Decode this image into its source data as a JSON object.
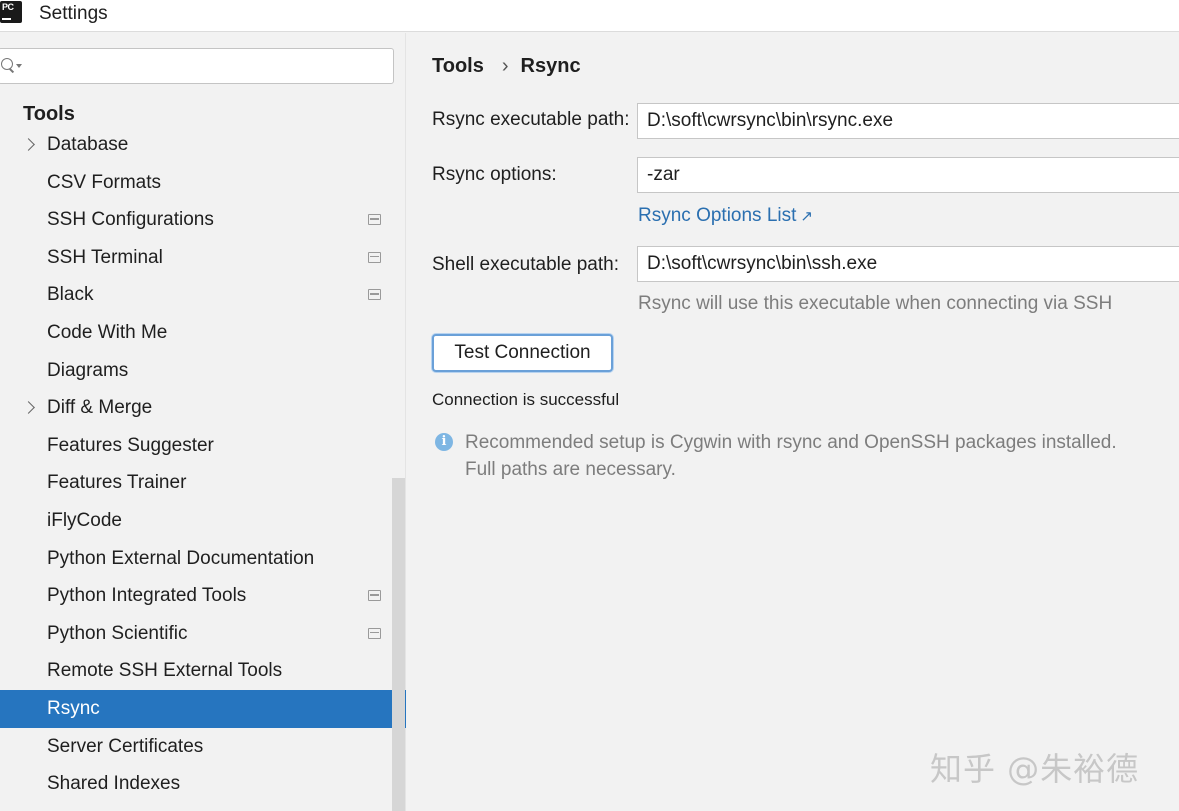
{
  "window": {
    "title": "Settings",
    "app_icon_text": "PC"
  },
  "sidebar": {
    "search": {
      "value": "",
      "placeholder": ""
    },
    "section_title": "Tools",
    "items": [
      {
        "label": "Database",
        "expandable": true,
        "project_icon": false,
        "selected": false
      },
      {
        "label": "CSV Formats",
        "expandable": false,
        "project_icon": false,
        "selected": false
      },
      {
        "label": "SSH Configurations",
        "expandable": false,
        "project_icon": true,
        "selected": false
      },
      {
        "label": "SSH Terminal",
        "expandable": false,
        "project_icon": true,
        "selected": false
      },
      {
        "label": "Black",
        "expandable": false,
        "project_icon": true,
        "selected": false
      },
      {
        "label": "Code With Me",
        "expandable": false,
        "project_icon": false,
        "selected": false
      },
      {
        "label": "Diagrams",
        "expandable": false,
        "project_icon": false,
        "selected": false
      },
      {
        "label": "Diff & Merge",
        "expandable": true,
        "project_icon": false,
        "selected": false
      },
      {
        "label": "Features Suggester",
        "expandable": false,
        "project_icon": false,
        "selected": false
      },
      {
        "label": "Features Trainer",
        "expandable": false,
        "project_icon": false,
        "selected": false
      },
      {
        "label": "iFlyCode",
        "expandable": false,
        "project_icon": false,
        "selected": false
      },
      {
        "label": "Python External Documentation",
        "expandable": false,
        "project_icon": false,
        "selected": false
      },
      {
        "label": "Python Integrated Tools",
        "expandable": false,
        "project_icon": true,
        "selected": false
      },
      {
        "label": "Python Scientific",
        "expandable": false,
        "project_icon": true,
        "selected": false
      },
      {
        "label": "Remote SSH External Tools",
        "expandable": false,
        "project_icon": false,
        "selected": false
      },
      {
        "label": "Rsync",
        "expandable": false,
        "project_icon": false,
        "selected": true
      },
      {
        "label": "Server Certificates",
        "expandable": false,
        "project_icon": false,
        "selected": false
      },
      {
        "label": "Shared Indexes",
        "expandable": false,
        "project_icon": false,
        "selected": false
      }
    ]
  },
  "main": {
    "breadcrumb": {
      "parent": "Tools",
      "separator": "›",
      "current": "Rsync"
    },
    "rsync_path": {
      "label": "Rsync executable path:",
      "value": "D:\\soft\\cwrsync\\bin\\rsync.exe"
    },
    "rsync_options": {
      "label": "Rsync options:",
      "value": "-zar"
    },
    "options_link": {
      "label": "Rsync Options List",
      "arrow": "↗"
    },
    "shell_path": {
      "label": "Shell executable path:",
      "value": "D:\\soft\\cwrsync\\bin\\ssh.exe"
    },
    "shell_hint": "Rsync will use this executable when connecting via SSH",
    "test_button": "Test Connection",
    "status": "Connection is successful",
    "info": {
      "icon": "i",
      "line1": "Recommended setup is Cygwin with rsync and OpenSSH packages installed.",
      "line2": "Full paths are necessary."
    }
  },
  "watermark": "知乎 @朱裕德",
  "colors": {
    "selection": "#2675bf",
    "link": "#2a6fb0",
    "info_icon": "#7eb6e3",
    "muted_text": "#7d7d7d"
  }
}
